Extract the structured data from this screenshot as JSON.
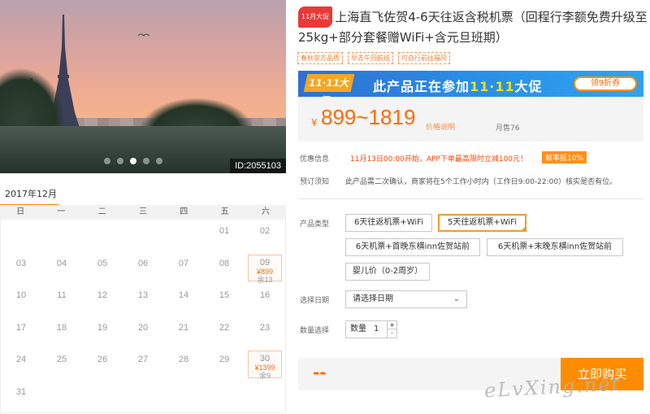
{
  "hero": {
    "photo_id": "ID:2055103",
    "active_slide": 3,
    "slide_count": 5
  },
  "calendar": {
    "month": "2017年12月",
    "weekdays": [
      "日",
      "一",
      "二",
      "三",
      "四",
      "五",
      "六"
    ],
    "rows": [
      [
        {
          "d": ""
        },
        {
          "d": ""
        },
        {
          "d": ""
        },
        {
          "d": ""
        },
        {
          "d": ""
        },
        {
          "d": "01"
        },
        {
          "d": "02"
        }
      ],
      [
        {
          "d": "03"
        },
        {
          "d": "04"
        },
        {
          "d": "05"
        },
        {
          "d": "06"
        },
        {
          "d": "07"
        },
        {
          "d": "08"
        },
        {
          "d": "09",
          "price": "¥899",
          "left": "余13"
        }
      ],
      [
        {
          "d": "10"
        },
        {
          "d": "11"
        },
        {
          "d": "12"
        },
        {
          "d": "13"
        },
        {
          "d": "14"
        },
        {
          "d": "15"
        },
        {
          "d": "16"
        }
      ],
      [
        {
          "d": "17"
        },
        {
          "d": "18"
        },
        {
          "d": "19"
        },
        {
          "d": "20"
        },
        {
          "d": "21"
        },
        {
          "d": "22"
        },
        {
          "d": "23"
        }
      ],
      [
        {
          "d": "24"
        },
        {
          "d": "25"
        },
        {
          "d": "26"
        },
        {
          "d": "27"
        },
        {
          "d": "28"
        },
        {
          "d": "29"
        },
        {
          "d": "30",
          "price": "¥1399",
          "left": "余9"
        }
      ],
      [
        {
          "d": "31"
        }
      ]
    ]
  },
  "product": {
    "badge": "11月大促",
    "title": "上海直飞佐贺4-6天往返含税机票（回程行李额免费升级至25kg+部分套餐赠WiFi+含元旦班期）",
    "tags": [
      "春秋官方品质",
      "早去午回航班",
      "可自行前往福冈"
    ]
  },
  "promo": {
    "logo": "11·11大促",
    "text_prefix": "此产品正在参加",
    "text_highlight": "11·11",
    "text_suffix": "大促",
    "coupon": "领9折券"
  },
  "price": {
    "currency": "¥",
    "range": "899~1819",
    "note": "价格说明",
    "sold": "月售76"
  },
  "offers": {
    "label": "优惠信息",
    "text": "11月13日00:00开始，APP下单最高限时立减100元！",
    "badge": "帧率抵10%"
  },
  "notice": {
    "label": "预订须知",
    "text": "此产品需二次确认，商家将在5个工作小时内（工作日9:00-22:00）核实是否有位。"
  },
  "product_type": {
    "label": "产品类型",
    "options": [
      "6天往返机票+WiFi",
      "5天往返机票+WiFi",
      "6天机票+首晚东横inn佐贺站前",
      "6天机票+末晚东横inn佐贺站前",
      "婴儿价（0-2周岁）"
    ],
    "selected_index": 1
  },
  "date_select": {
    "label": "选择日期",
    "placeholder": "请选择日期"
  },
  "quantity": {
    "label": "数量选择",
    "prefix": "数量",
    "value": "1",
    "inc": "+",
    "dec": "-"
  },
  "buy": {
    "price_placeholder": "--",
    "button": "立即购买"
  },
  "watermark": "eLvXing.net"
}
